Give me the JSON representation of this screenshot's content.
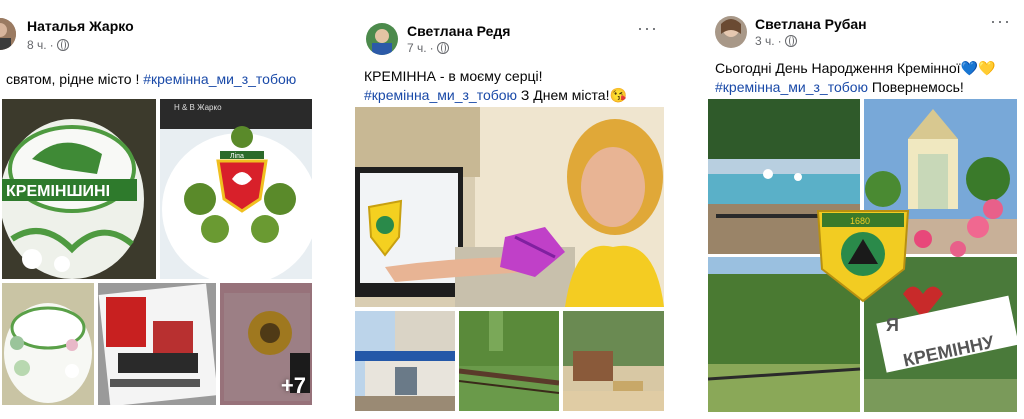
{
  "posts": [
    {
      "author": "Наталья Жарко",
      "time": "8 ч.",
      "text_plain": "святом, рідне місто ! ",
      "hashtag": "#кремінна_ми_з_тобою",
      "text_after": "",
      "photo_watermark": "Н & В Жарко",
      "cake_text": "КРЕМІНШИНІ",
      "badge_text": "Ліпа",
      "more_count": "+7"
    },
    {
      "author": "Светлана Редя",
      "time": "7 ч.",
      "more_label": "···",
      "line1": "КРЕМІННА - в моєму серці!",
      "hashtag": "#кремінна_ми_з_тобою",
      "text_after": " З Днем міста!😘"
    },
    {
      "author": "Светлана Рубан",
      "time": "3 ч.",
      "more_label": "···",
      "line1": "Сьогодні День Народження Кремінної💙💛",
      "hashtag": "#кремінна_ми_з_тобою",
      "text_after": " Повернемось!",
      "coat_year": "1680",
      "sign_ya": "Я",
      "sign_city": "КРЕМІННУ"
    }
  ]
}
